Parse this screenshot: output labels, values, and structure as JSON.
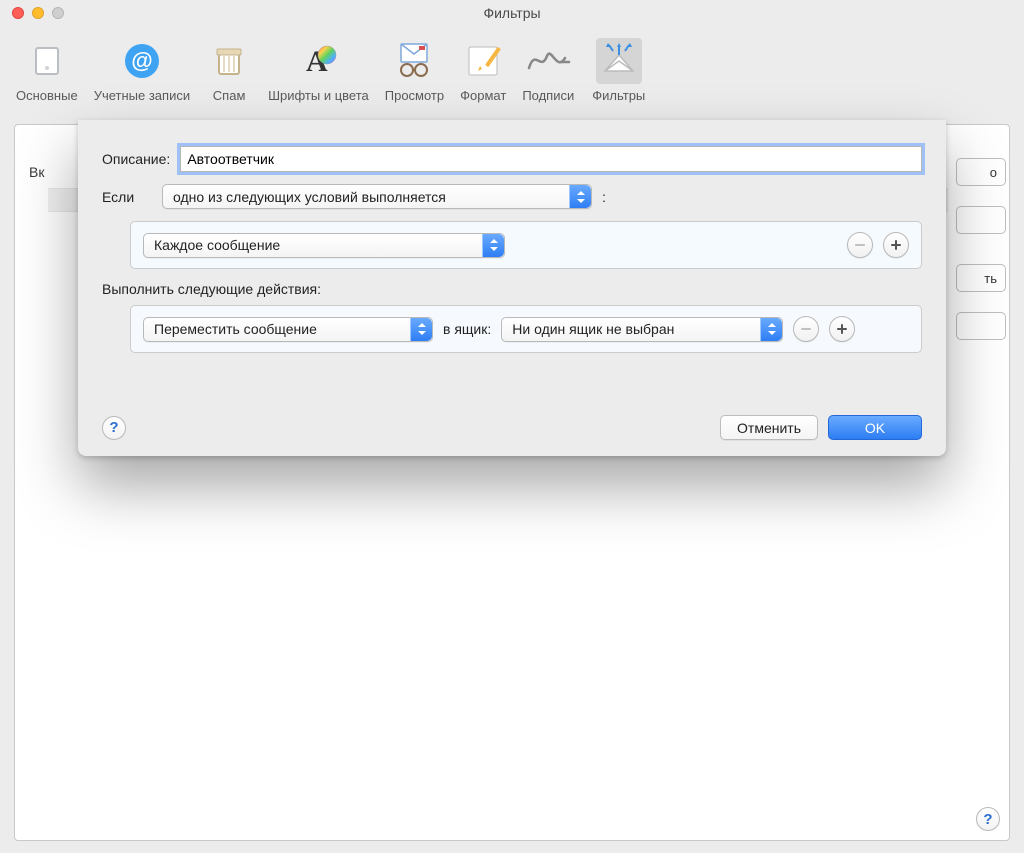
{
  "window": {
    "title": "Фильтры"
  },
  "toolbar": {
    "items": [
      {
        "label": "Основные"
      },
      {
        "label": "Учетные записи"
      },
      {
        "label": "Спам"
      },
      {
        "label": "Шрифты и цвета"
      },
      {
        "label": "Просмотр"
      },
      {
        "label": "Формат"
      },
      {
        "label": "Подписи"
      },
      {
        "label": "Фильтры"
      }
    ]
  },
  "background": {
    "left_label_fragment": "Вк",
    "peek1": "о",
    "peek2": "",
    "peek3": "ть",
    "peek4": ""
  },
  "sheet": {
    "description_label": "Описание:",
    "description_value": "Автоответчик",
    "if_label": "Если",
    "if_condition": "одно из следующих условий выполняется",
    "if_colon": ":",
    "criteria": {
      "field": "Каждое сообщение"
    },
    "actions_label": "Выполнить следующие действия:",
    "action": {
      "type": "Переместить сообщение",
      "mid_label": "в ящик:",
      "target": "Ни один ящик не выбран"
    },
    "cancel": "Отменить",
    "ok": "OK",
    "help": "?"
  },
  "global_help": "?"
}
